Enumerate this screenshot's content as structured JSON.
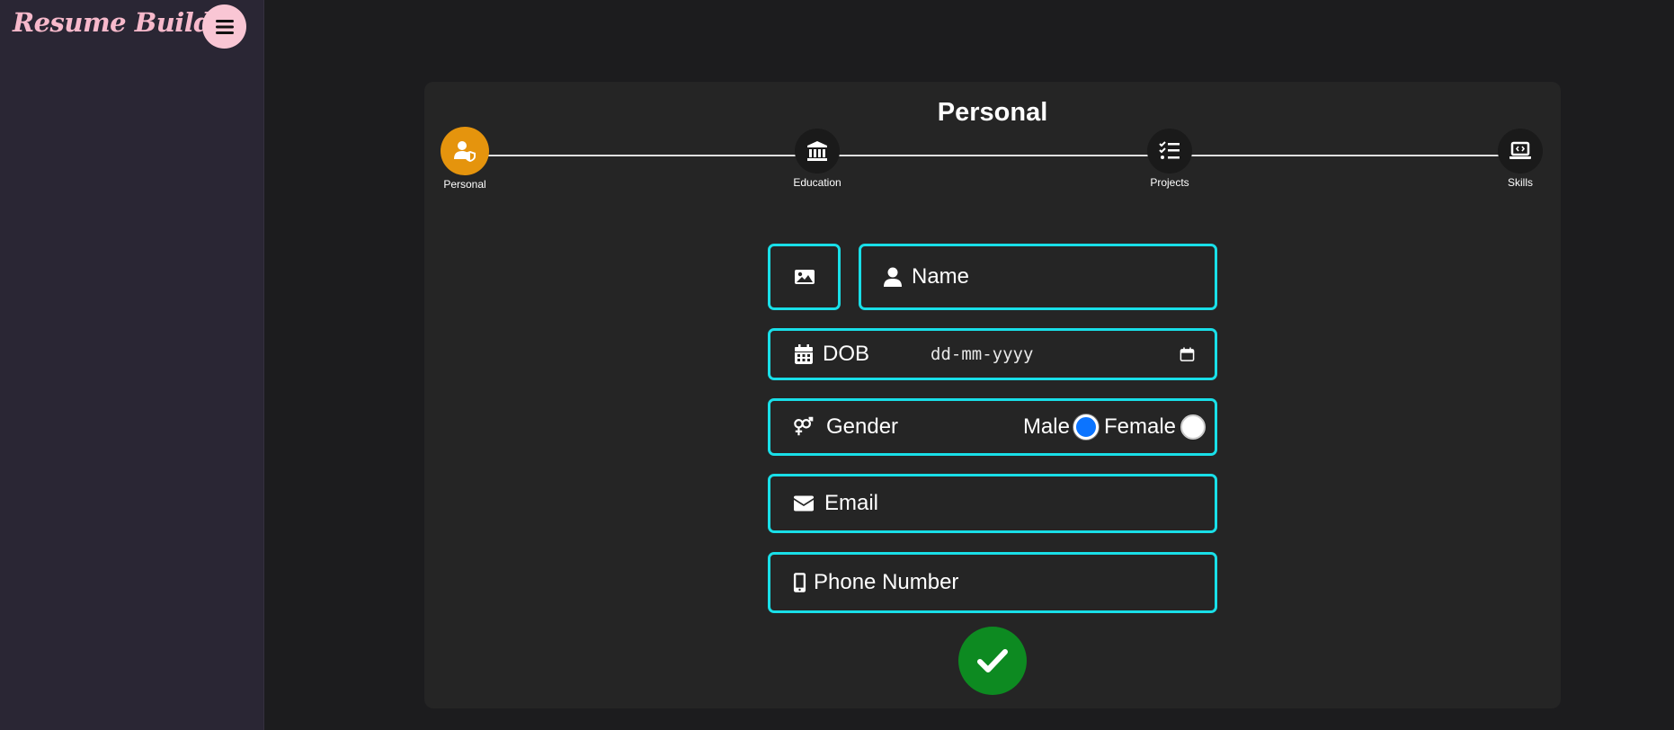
{
  "app": {
    "brand": "Resume Builder",
    "menu_icon": "hamburger-menu-icon"
  },
  "form": {
    "title": "Personal",
    "steps": [
      {
        "label": "Personal",
        "icon": "user-shield-icon",
        "active": true
      },
      {
        "label": "Education",
        "icon": "institution-icon",
        "active": false
      },
      {
        "label": "Projects",
        "icon": "tasks-list-icon",
        "active": false
      },
      {
        "label": "Skills",
        "icon": "laptop-code-icon",
        "active": false
      }
    ],
    "name_placeholder": "Name",
    "dob_label": "DOB",
    "dob_value": "dd-mm-yyyy",
    "gender_label": "Gender",
    "gender_options": [
      "Male",
      "Female"
    ],
    "gender_selected": "Male",
    "email_placeholder": "Email",
    "phone_placeholder": "Phone Number"
  },
  "colors": {
    "accent": "#19dfe8",
    "active_step": "#e5940d",
    "submit": "#0d8a21",
    "brand": "#f7b9cb"
  }
}
